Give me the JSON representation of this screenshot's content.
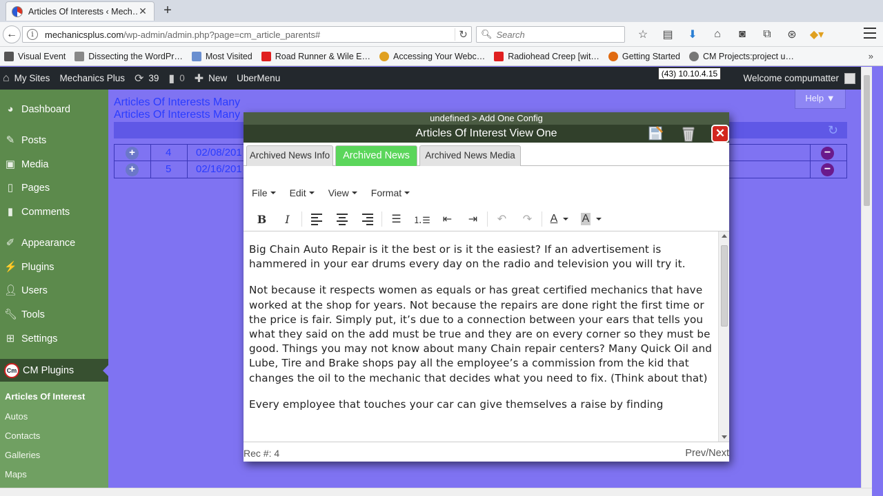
{
  "browser": {
    "tab_title": "Articles Of Interests ‹ Mech…",
    "url_host": "mechanicsplus.com",
    "url_path": "/wp-admin/admin.php?page=cm_article_parents#",
    "search_placeholder": "Search",
    "bookmarks": [
      {
        "label": "Visual Event",
        "color": "#555555"
      },
      {
        "label": "Dissecting the WordPr…",
        "color": "#888888"
      },
      {
        "label": "Most Visited",
        "color": "#6a8fd0"
      },
      {
        "label": "Road Runner & Wile E…",
        "color": "#e02020"
      },
      {
        "label": "Accessing Your Webc…",
        "color": "#e0a020"
      },
      {
        "label": "Radiohead Creep [wit…",
        "color": "#e02020"
      },
      {
        "label": "Getting Started",
        "color": "#e06a10"
      },
      {
        "label": "CM Projects:project u…",
        "color": "#777777"
      }
    ]
  },
  "adminbar": {
    "my_sites": "My Sites",
    "site_name": "Mechanics Plus",
    "updates_count": "39",
    "comments_count": "0",
    "new_label": "New",
    "ubermenu": "UberMenu",
    "ip_badge": "(43) 10.10.4.15",
    "welcome": "Welcome compumatter"
  },
  "sidebar": {
    "items": {
      "dashboard": "Dashboard",
      "posts": "Posts",
      "media": "Media",
      "pages": "Pages",
      "comments": "Comments",
      "appearance": "Appearance",
      "plugins": "Plugins",
      "users": "Users",
      "tools": "Tools",
      "settings": "Settings",
      "cm_plugins": "CM Plugins"
    },
    "submenu": {
      "articles": "Articles Of Interest",
      "autos": "Autos",
      "contacts": "Contacts",
      "galleries": "Galleries",
      "maps": "Maps"
    }
  },
  "main": {
    "title_1": "Articles Of Interests Many",
    "title_2": "Articles Of Interests Many",
    "help": "Help ▼",
    "rows": [
      {
        "num": "4",
        "date": "02/08/201"
      },
      {
        "num": "5",
        "date": "02/16/201"
      }
    ]
  },
  "modal": {
    "top_bar": "undefined > Add One Config",
    "title": "Articles Of Interest View One",
    "tabs": {
      "info": "Archived News Info",
      "news": "Archived News",
      "media": "Archived News Media"
    },
    "menus": {
      "file": "File",
      "edit": "Edit",
      "view": "View",
      "format": "Format"
    },
    "content": {
      "p1": "Big Chain  Auto Repair is it the best or is it the easiest? If an advertisement is hammered in your ear drums every day on the radio and television you will try it.",
      "p2": "Not because it respects women as equals or has great certified mechanics that have worked at the shop for years. Not because the repairs are done right the first time or the price is fair. Simply put, it’s due to a connection between your ears that tells you what they said on the add must be true and they are on every corner so they must be good. Things you may not know about many Chain repair centers? Many Quick Oil and Lube, Tire and Brake shops pay all the employee’s a commission from the kid that changes the oil to the mechanic that decides what you need to fix. (Think about that)",
      "p3": "Every employee that touches your car can give themselves a raise by finding"
    },
    "footer": {
      "rec": "Rec #: 4",
      "prevnext": "Prev/Next"
    }
  }
}
